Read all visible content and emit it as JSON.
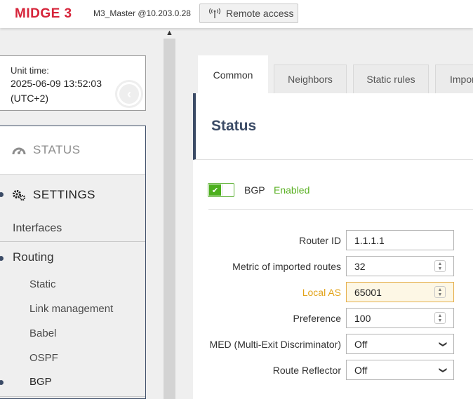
{
  "header": {
    "logo": "MIDGE 3",
    "device": "M3_Master @10.203.0.28",
    "remote_access_label": "Remote access"
  },
  "sidebar": {
    "unit_time_label": "Unit time:",
    "unit_time_value": "2025-06-09 13:52:03",
    "unit_time_tz": "(UTC+2)",
    "status_label": "STATUS",
    "settings_label": "SETTINGS",
    "interfaces_label": "Interfaces",
    "routing_label": "Routing",
    "routing_items": [
      "Static",
      "Link management",
      "Babel",
      "OSPF",
      "BGP"
    ]
  },
  "tabs": [
    "Common",
    "Neighbors",
    "Static rules",
    "Impor"
  ],
  "panel": {
    "title": "Status",
    "bgp_label": "BGP",
    "bgp_state": "Enabled",
    "fields": {
      "router_id": {
        "label": "Router ID",
        "value": "1.1.1.1"
      },
      "metric": {
        "label": "Metric of imported routes",
        "value": "32"
      },
      "local_as": {
        "label": "Local AS",
        "value": "65001"
      },
      "preference": {
        "label": "Preference",
        "value": "100"
      },
      "med": {
        "label": "MED (Multi-Exit Discriminator)",
        "value": "Off"
      },
      "route_reflector": {
        "label": "Route Reflector",
        "value": "Off"
      }
    }
  },
  "colors": {
    "brand": "#d6243a",
    "nav_accent": "#3b4b66",
    "enabled": "#59b022",
    "warning": "#e2a319"
  }
}
